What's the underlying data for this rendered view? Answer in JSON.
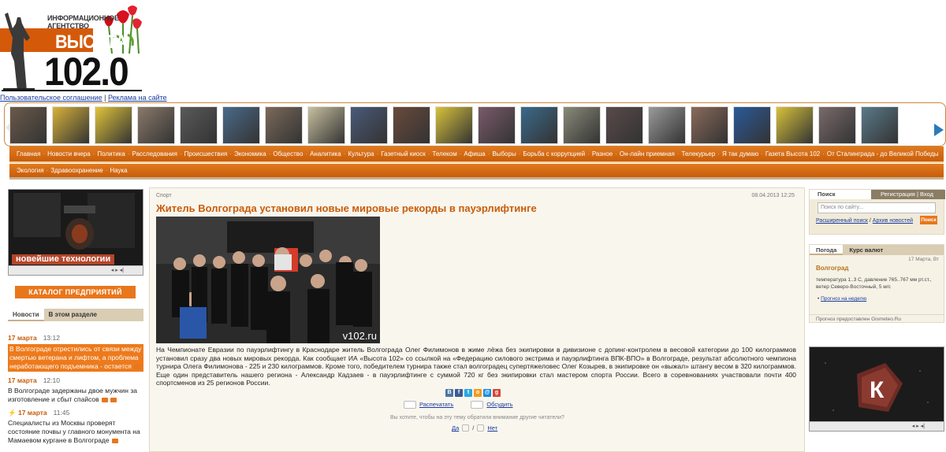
{
  "header": {
    "agency_label": "ИНФОРМАЦИОННОЕ АГЕНТСТВО",
    "brand_word": "ВЫСОТА",
    "brand_number": "102.0"
  },
  "top_links": {
    "agreement": "Пользовательское соглашение",
    "separator": "|",
    "advertising": "Реклама на сайте"
  },
  "nav_row1": [
    "Главная",
    "Новости вчера",
    "Политика",
    "Расследования",
    "Происшествия",
    "Экономика",
    "Общество",
    "Аналитика",
    "Культура",
    "Газетный киоск",
    "Телеком",
    "Афиша",
    "Выборы",
    "Борьба с коррупцией",
    "Разное",
    "Он-лайн приемная",
    "Телекурьер",
    "Я так думаю",
    "Газета Высота 102",
    "От Сталинграда - до Великой Победы"
  ],
  "nav_row2": [
    "Экология",
    "Здравоохранение",
    "Наука"
  ],
  "left": {
    "video_banner": "новейшие технологии",
    "catalog_button": "КАТАЛОГ ПРЕДПРИЯТИЙ",
    "tab_news": "Новости",
    "tab_section": "В этом разделе",
    "news": [
      {
        "date": "17 марта",
        "time": "13:12",
        "text": "В Волгограде отрестились от связи между смертью ветерана и лифтом, а проблема неработающего подъемника - остается",
        "highlight": true
      },
      {
        "date": "17 марта",
        "time": "12:10",
        "text": "В Волгограде задержаны двое мужчин за изготовление и сбыт спайсов",
        "highlight": false
      },
      {
        "date": "17 марта",
        "time": "11:45",
        "text": "Специалисты из Москвы проверят состояние почвы у главного монумента на Мамаевом кургане в Волгограде",
        "highlight": false
      }
    ]
  },
  "article": {
    "rubric": "Спорт",
    "date": "08.04.2013 12:25",
    "title": "Житель Волгограда установил новые мировые рекорды в пауэрлифтинге",
    "photo_caption": "v102.ru",
    "body": "На Чемпионате Евразии по пауэрлифтингу в Краснодаре житель Волгограда Олег Филимонов в жиме лёжа без экипировки в дивизионе с допинг-контролем в весовой категории до 100 килограммов установил сразу два новых мировых рекорда. Как сообщает ИА «Высота 102» со ссылкой на «Федерацию силового экстрима и пауэрлифтинга ВПК-ВПО» в Волгограде, результат абсолютного чемпиона турнира Олега Филимонова - 225 и 230 килограммов. Кроме того, победителем турнира также стал волгоградец супертяжеловес Олег Козырев, в экипировке он «выжал» штангу весом в 320 килограммов. Еще один представитель нашего региона - Александр Кадзаев - в пауэрлифтинге с суммой 720 кг без экипировки стал мастером спорта России. Всего в соревнованиях участвовали почти 400 спортсменов из 25 регионов России.",
    "print_label": "Распечатать",
    "discuss_label": "Обсудить",
    "ask_text": "Вы хотите, чтобы на эту тему обратили внимание другие читатели?",
    "yes_label": "Да",
    "slash": "/",
    "no_label": "Нет",
    "share_icons": [
      "vk",
      "fb",
      "tw",
      "ok",
      "mail",
      "g+"
    ]
  },
  "right": {
    "tab_search": "Поиск",
    "tab_register": "Регистрация",
    "tab_sep": "|",
    "tab_login": "Вход",
    "search_placeholder": "Поиск по сайту...",
    "advanced_search": "Расширенный поиск",
    "archive": "Архив новостей",
    "link_sep": "/",
    "search_button": "Поиск",
    "tab_weather": "Погода",
    "tab_currency": "Курс валют",
    "weather_date": "17 Марта, Вт",
    "city": "Волгоград",
    "weather_info": "температура 1..3 С, давление 765..767 мм рт.ст., ветер Северо-Восточный, 5 м/с",
    "forecast_link": "Прогноз на неделю",
    "provider": "Прогноз предоставлен Gismeteo.Ru"
  },
  "colors": {
    "accent": "#e8761b",
    "nav": "#d0670f",
    "title": "#c85d0a",
    "link": "#1a3c9c"
  }
}
